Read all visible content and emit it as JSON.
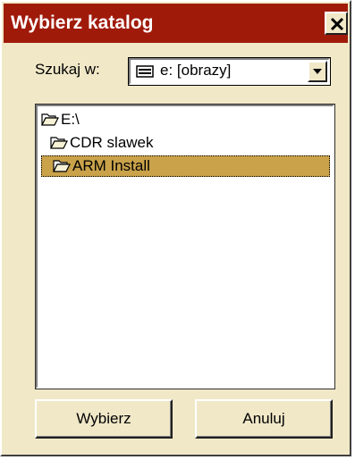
{
  "window": {
    "title": "Wybierz katalog",
    "close_icon": "close-icon"
  },
  "lookin": {
    "label": "Szukaj w:",
    "value": "e: [obrazy]",
    "drive_icon": "drive-icon",
    "arrow_icon": "chevron-down-icon"
  },
  "folders": [
    {
      "label": "E:\\",
      "icon": "open-folder-icon",
      "selected": false
    },
    {
      "label": "CDR slawek",
      "icon": "open-folder-icon",
      "selected": false
    },
    {
      "label": "ARM Install",
      "icon": "open-folder-icon",
      "selected": true
    }
  ],
  "buttons": {
    "ok_label": "Wybierz",
    "cancel_label": "Anuluj"
  },
  "colors": {
    "titlebar": "#a01a0a",
    "face": "#f1e8c8",
    "selection": "#c9a24a"
  }
}
